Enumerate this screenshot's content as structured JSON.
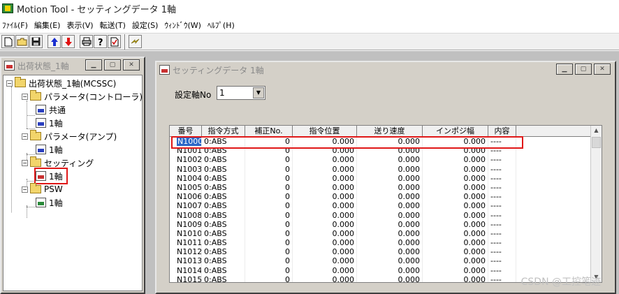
{
  "app": {
    "title": "Motion Tool - セッティングデータ 1軸"
  },
  "menu": [
    "ﾌｧｲﾙ(F)",
    "編集(E)",
    "表示(V)",
    "転送(T)",
    "設定(S)",
    "ｳｨﾝﾄﾞｳ(W)",
    "ﾍﾙﾌﾟ(H)"
  ],
  "toolbar": {
    "icons": [
      "new-file-icon",
      "open-folder-icon",
      "save-icon",
      "upload-icon",
      "download-icon",
      "print-icon",
      "help-icon",
      "check-icon",
      "transfer-icon"
    ]
  },
  "tree_window": {
    "title": "出荷状態_1軸",
    "nodes": [
      {
        "label": "出荷状態_1軸(MCSSC)"
      },
      {
        "label": "パラメータ(コントローラ)"
      },
      {
        "label": "共通"
      },
      {
        "label": "1軸"
      },
      {
        "label": "パラメータ(アンプ)"
      },
      {
        "label": "1軸"
      },
      {
        "label": "セッティング"
      },
      {
        "label": "1軸"
      },
      {
        "label": "PSW"
      },
      {
        "label": "1軸"
      }
    ],
    "icon_text": {
      "prm": "PRM",
      "set": "SET",
      "psw": "PSW"
    }
  },
  "setting_window": {
    "title": "セッティングデータ 1軸",
    "axis_label": "設定軸No",
    "axis_value": "1",
    "columns": [
      "番号",
      "指令方式",
      "補正No.",
      "指令位置",
      "送り速度",
      "インポジ幅",
      "内容"
    ],
    "rows": [
      [
        "N1000",
        "0:ABS",
        "0",
        "0.000",
        "0.000",
        "0.000",
        "----"
      ],
      [
        "N1001",
        "0:ABS",
        "0",
        "0.000",
        "0.000",
        "0.000",
        "----"
      ],
      [
        "N1002",
        "0:ABS",
        "0",
        "0.000",
        "0.000",
        "0.000",
        "----"
      ],
      [
        "N1003",
        "0:ABS",
        "0",
        "0.000",
        "0.000",
        "0.000",
        "----"
      ],
      [
        "N1004",
        "0:ABS",
        "0",
        "0.000",
        "0.000",
        "0.000",
        "----"
      ],
      [
        "N1005",
        "0:ABS",
        "0",
        "0.000",
        "0.000",
        "0.000",
        "----"
      ],
      [
        "N1006",
        "0:ABS",
        "0",
        "0.000",
        "0.000",
        "0.000",
        "----"
      ],
      [
        "N1007",
        "0:ABS",
        "0",
        "0.000",
        "0.000",
        "0.000",
        "----"
      ],
      [
        "N1008",
        "0:ABS",
        "0",
        "0.000",
        "0.000",
        "0.000",
        "----"
      ],
      [
        "N1009",
        "0:ABS",
        "0",
        "0.000",
        "0.000",
        "0.000",
        "----"
      ],
      [
        "N1010",
        "0:ABS",
        "0",
        "0.000",
        "0.000",
        "0.000",
        "----"
      ],
      [
        "N1011",
        "0:ABS",
        "0",
        "0.000",
        "0.000",
        "0.000",
        "----"
      ],
      [
        "N1012",
        "0:ABS",
        "0",
        "0.000",
        "0.000",
        "0.000",
        "----"
      ],
      [
        "N1013",
        "0:ABS",
        "0",
        "0.000",
        "0.000",
        "0.000",
        "----"
      ],
      [
        "N1014",
        "0:ABS",
        "0",
        "0.000",
        "0.000",
        "0.000",
        "----"
      ],
      [
        "N1015",
        "0:ABS",
        "0",
        "0.000",
        "0.000",
        "0.000",
        "----"
      ]
    ]
  },
  "watermark": "CSDN @工控笔迹",
  "colors": {
    "highlight": "#e01818",
    "selection": "#2a67c8"
  }
}
